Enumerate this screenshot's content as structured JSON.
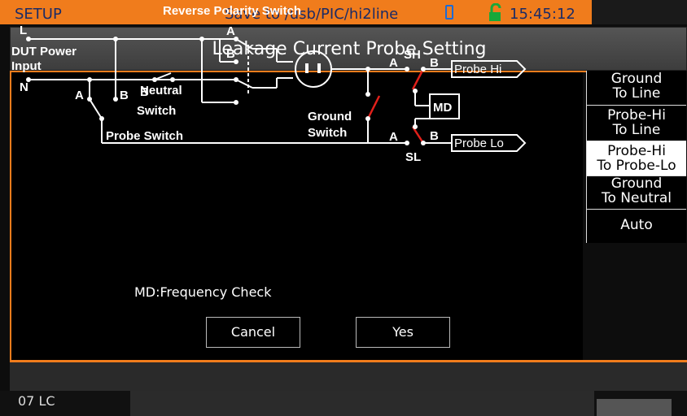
{
  "statusbar": {
    "mode": "SETUP",
    "save_path": "Save to /usb/PIC/hi2line",
    "time": "15:45:12"
  },
  "dialog": {
    "title": "Leakage Current Probe Setting",
    "note": "MD:Frequency Check",
    "cancel_label": "Cancel",
    "yes_label": "Yes"
  },
  "sidebar": {
    "items": [
      {
        "line1": "Ground",
        "line2": "To Line",
        "selected": false
      },
      {
        "line1": "Probe-Hi",
        "line2": "To Line",
        "selected": false
      },
      {
        "line1": "Probe-Hi",
        "line2": "To Probe-Lo",
        "selected": true
      },
      {
        "line1": "Ground",
        "line2": "To Neutral",
        "selected": false
      },
      {
        "line1": "Auto",
        "line2": "",
        "selected": false
      }
    ]
  },
  "diagram": {
    "title": "Reverse Polarity Switch",
    "label_l": "L",
    "label_n": "N",
    "dut_line1": "DUT Power",
    "dut_line2": "Input",
    "label_a": "A",
    "label_b": "B",
    "neutral_line1": "Neutral",
    "neutral_line2": "Switch",
    "probe_switch": "Probe  Switch",
    "ground_line1": "Ground",
    "ground_line2": "Switch",
    "sh": "SH",
    "sl": "SL",
    "md": "MD",
    "probe_hi": "Probe  Hi",
    "probe_lo": "Probe  Lo"
  },
  "bottom": {
    "text": "07     LC"
  },
  "colors": {
    "accent": "#f07c1c",
    "switch_red": "#e0201a"
  }
}
